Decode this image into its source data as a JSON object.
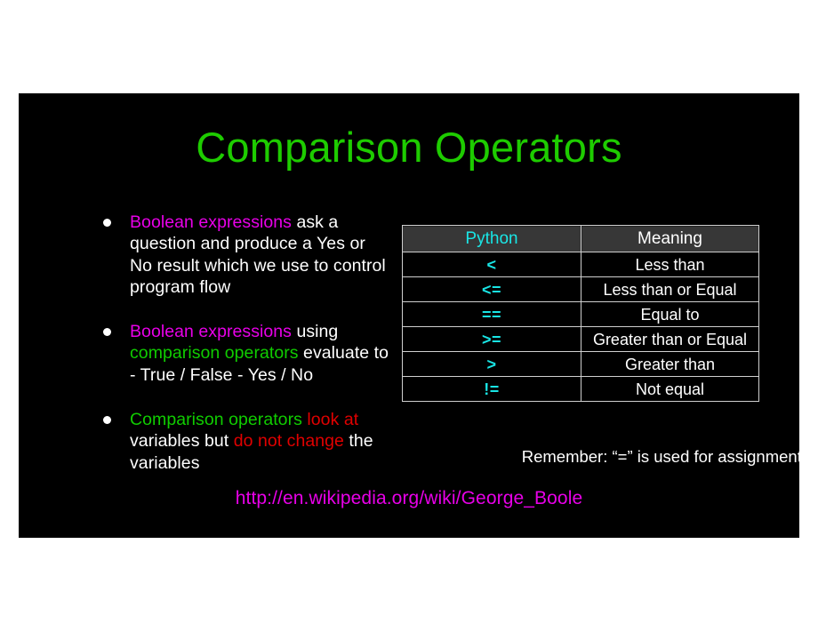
{
  "slide": {
    "background_color": "#000000",
    "title": "Comparison Operators",
    "title_color": "#1ecc00"
  },
  "bullets": [
    {
      "segments": [
        {
          "text": "Boolean expressions",
          "color": "#e800e8"
        },
        {
          "text": " ask a question and produce a Yes or No result which we use to control program flow",
          "color": "#ffffff"
        }
      ]
    },
    {
      "segments": [
        {
          "text": "Boolean expressions",
          "color": "#e800e8"
        },
        {
          "text": " using ",
          "color": "#ffffff"
        },
        {
          "text": "comparison operators",
          "color": "#10cc00"
        },
        {
          "text": "  evaluate to - True / False - Yes / No",
          "color": "#ffffff"
        }
      ]
    },
    {
      "segments": [
        {
          "text": "Comparison operators",
          "color": "#10cc00"
        },
        {
          "text": " ",
          "color": "#ffffff"
        },
        {
          "text": "look at",
          "color": "#e00000"
        },
        {
          "text": " variables but ",
          "color": "#ffffff"
        },
        {
          "text": "do not change",
          "color": "#e00000"
        },
        {
          "text": " the variables",
          "color": "#ffffff"
        }
      ]
    }
  ],
  "table": {
    "headers": [
      "Python",
      "Meaning"
    ],
    "header_python_color": "#19e5e5",
    "header_meaning_color": "#ffffff",
    "operator_color": "#19e5e5",
    "rows": [
      {
        "python": "<",
        "meaning": "Less than"
      },
      {
        "python": "<=",
        "meaning": "Less than or Equal"
      },
      {
        "python": "==",
        "meaning": "Equal to"
      },
      {
        "python": ">=",
        "meaning": "Greater than or Equal"
      },
      {
        "python": ">",
        "meaning": "Greater than"
      },
      {
        "python": "!=",
        "meaning": "Not equal"
      }
    ]
  },
  "note": {
    "remember": "Remember: “=” is used for assignment."
  },
  "link": {
    "url_text": "http://en.wikipedia.org/wiki/George_Boole",
    "url_color": "#e800e8"
  }
}
